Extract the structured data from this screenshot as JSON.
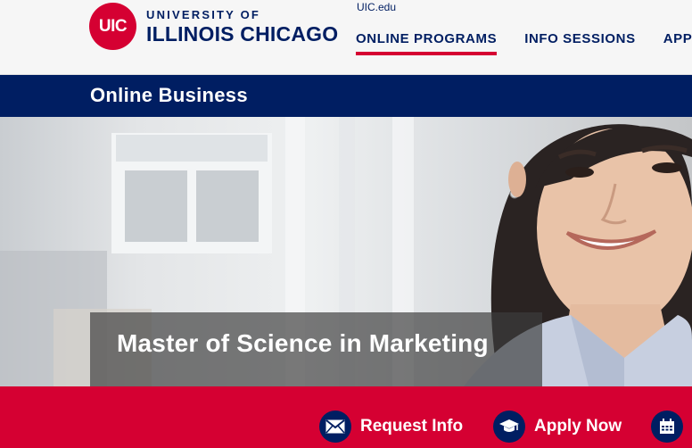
{
  "header": {
    "logo": {
      "badge": "UIC",
      "line1": "UNIVERSITY OF",
      "line2": "ILLINOIS CHICAGO"
    },
    "top_link": "UIC.edu",
    "nav": [
      {
        "label": "ONLINE PROGRAMS",
        "active": true
      },
      {
        "label": "INFO SESSIONS",
        "active": false
      },
      {
        "label": "APP",
        "active": false
      }
    ]
  },
  "banner": {
    "title": "Online Business"
  },
  "hero": {
    "heading": "Master of Science in Marketing",
    "image": "student-portrait-photo"
  },
  "cta": [
    {
      "label": "Request Info",
      "icon": "envelope-icon"
    },
    {
      "label": "Apply Now",
      "icon": "graduation-cap-icon"
    },
    {
      "label": "",
      "icon": "calendar-icon"
    }
  ],
  "colors": {
    "red": "#d50032",
    "navy": "#001e62",
    "header_bg": "#f6f6f6"
  }
}
